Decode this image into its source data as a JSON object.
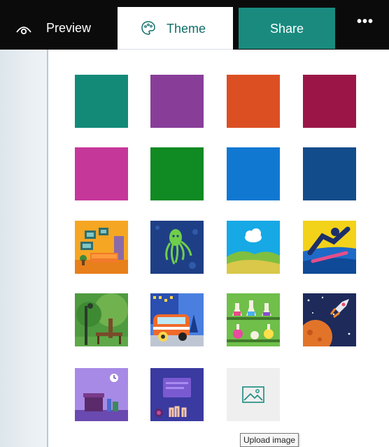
{
  "toolbar": {
    "preview_label": "Preview",
    "theme_label": "Theme",
    "share_label": "Share",
    "more_label": "•••",
    "icons": {
      "preview": "eye-icon",
      "theme": "palette-icon",
      "more": "more-options-icon"
    },
    "colors": {
      "bar": "#0b0b0b",
      "share": "#1a8a7f",
      "theme_text": "#0f6e68"
    }
  },
  "themes": {
    "color_swatches": [
      {
        "name": "teal",
        "color": "#138a78"
      },
      {
        "name": "purple",
        "color": "#883e99"
      },
      {
        "name": "orange",
        "color": "#dc4f23"
      },
      {
        "name": "crimson",
        "color": "#9b1646"
      },
      {
        "name": "magenta",
        "color": "#c6379a"
      },
      {
        "name": "green",
        "color": "#108a22"
      },
      {
        "name": "blue",
        "color": "#1178d2"
      },
      {
        "name": "navy",
        "color": "#134c8a"
      }
    ],
    "image_swatches": [
      "living-room",
      "octopus",
      "hills-cloud",
      "snowboarder",
      "park-bench",
      "camper-van",
      "lab-flasks",
      "rocket-space",
      "desk-clock",
      "video-call"
    ],
    "upload": {
      "icon": "image-icon",
      "tooltip": "Upload image"
    }
  }
}
